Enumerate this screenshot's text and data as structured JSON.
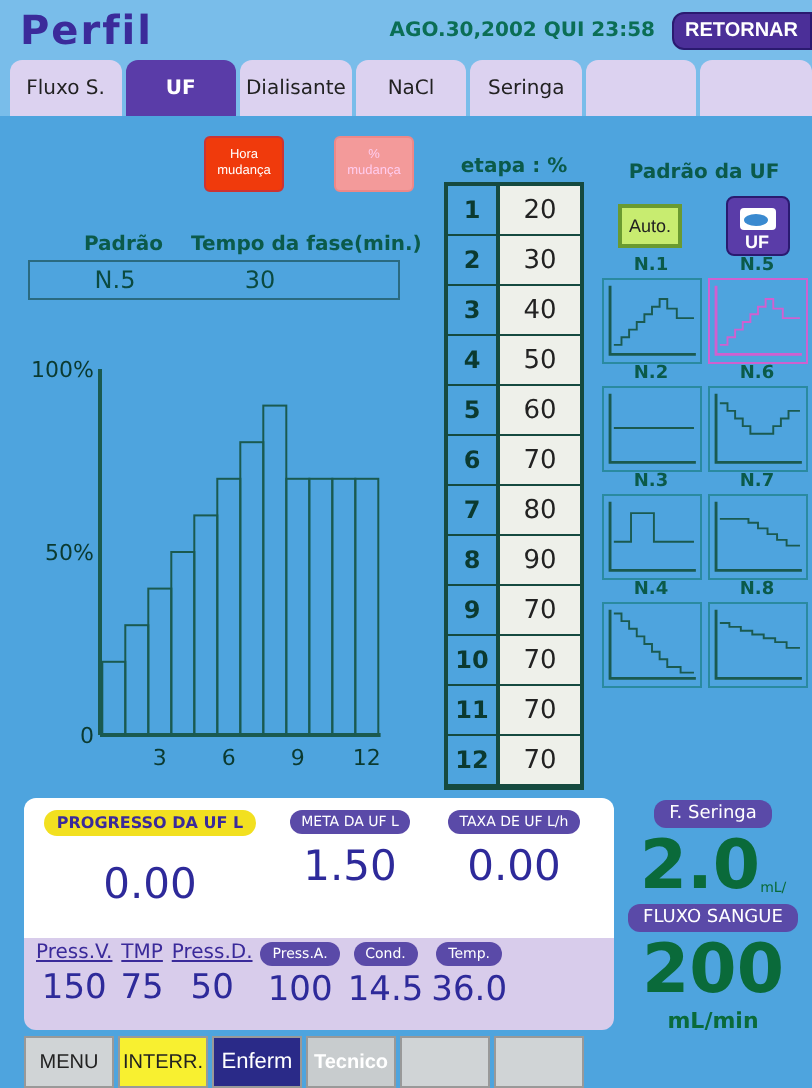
{
  "header": {
    "title": "Perfil",
    "datetime": "AGO.30,2002 QUI 23:58",
    "return_button": "RETORNAR"
  },
  "tabs": [
    {
      "kind": "tab",
      "label": "Fluxo S.",
      "selected": false
    },
    {
      "kind": "tab",
      "label": "UF",
      "selected": true
    },
    {
      "kind": "tab",
      "label": "Dialisante",
      "selected": false
    },
    {
      "kind": "tab",
      "label": "NaCl",
      "selected": false
    },
    {
      "kind": "tab",
      "label": "Seringa",
      "selected": false
    },
    {
      "kind": "blank"
    },
    {
      "kind": "blank"
    }
  ],
  "change_buttons": [
    {
      "label": "Hora mudança",
      "selected": true
    },
    {
      "label": "% mudança",
      "selected": false
    }
  ],
  "pattern_info": {
    "pattern_label": "Padrão",
    "time_label": "Tempo da fase(min.)",
    "pattern_value": "N.5",
    "time_value": "30"
  },
  "chart_data": {
    "type": "bar",
    "x": [
      1,
      2,
      3,
      4,
      5,
      6,
      7,
      8,
      9,
      10,
      11,
      12
    ],
    "values": [
      20,
      30,
      40,
      50,
      60,
      70,
      80,
      90,
      70,
      70,
      70,
      70
    ],
    "ylim": [
      0,
      100
    ],
    "yticks": [
      {
        "value": 0,
        "label": "0"
      },
      {
        "value": 50,
        "label": "50%"
      },
      {
        "value": 100,
        "label": "100%"
      }
    ],
    "xlim": [
      0.4,
      12.6
    ],
    "xticks": [
      3,
      6,
      9,
      12
    ]
  },
  "steps": {
    "title": "etapa : %",
    "rows": [
      {
        "step": "1",
        "percent": "20"
      },
      {
        "step": "2",
        "percent": "30"
      },
      {
        "step": "3",
        "percent": "40"
      },
      {
        "step": "4",
        "percent": "50"
      },
      {
        "step": "5",
        "percent": "60"
      },
      {
        "step": "6",
        "percent": "70"
      },
      {
        "step": "7",
        "percent": "80"
      },
      {
        "step": "8",
        "percent": "90"
      },
      {
        "step": "9",
        "percent": "70"
      },
      {
        "step": "10",
        "percent": "70"
      },
      {
        "step": "11",
        "percent": "70"
      },
      {
        "step": "12",
        "percent": "70"
      }
    ]
  },
  "uf_patterns": {
    "title": "Padrão da UF",
    "auto_button": "Auto.",
    "uf_button": "UF",
    "patterns": [
      {
        "label": "N.1",
        "kind": "ramp",
        "selected": false
      },
      {
        "label": "N.5",
        "kind": "ramp",
        "selected": true
      },
      {
        "label": "N.2",
        "kind": "flat",
        "selected": false
      },
      {
        "label": "N.6",
        "kind": "valley",
        "selected": false
      },
      {
        "label": "N.3",
        "kind": "pulse",
        "selected": false
      },
      {
        "label": "N.7",
        "kind": "late_decline",
        "selected": false
      },
      {
        "label": "N.4",
        "kind": "steep_decline",
        "selected": false
      },
      {
        "label": "N.8",
        "kind": "gentle_decline",
        "selected": false
      }
    ]
  },
  "uf_panel": {
    "progress": {
      "label": "PROGRESSO DA UF  L",
      "value": "0.00"
    },
    "goal": {
      "label": "META DA UF  L",
      "value": "1.50"
    },
    "rate": {
      "label": "TAXA DE UF  L/h",
      "value": "0.00"
    },
    "readings": [
      {
        "kind": "plain",
        "label": "Press.V.",
        "value": "150"
      },
      {
        "kind": "plain",
        "label": "TMP",
        "value": "75"
      },
      {
        "kind": "plain",
        "label": "Press.D.",
        "value": "50"
      },
      {
        "kind": "pill",
        "label": "Press.A.",
        "value": "100"
      },
      {
        "kind": "pill",
        "label": "Cond.",
        "value": "14.5"
      },
      {
        "kind": "pill",
        "label": "Temp.",
        "value": "36.0"
      }
    ]
  },
  "syringe": {
    "label": "F. Seringa",
    "value": "2.0",
    "unit": "mL/"
  },
  "blood_flow": {
    "label": "FLUXO SANGUE",
    "value": "200",
    "unit": "mL/min"
  },
  "menu": [
    {
      "kind": "gray",
      "label": "MENU"
    },
    {
      "kind": "yellow",
      "label": "INTERR."
    },
    {
      "kind": "active",
      "label": "Enferm"
    },
    {
      "kind": "disabled",
      "label": "Tecnico"
    },
    {
      "kind": "blank"
    },
    {
      "kind": "blank"
    }
  ]
}
